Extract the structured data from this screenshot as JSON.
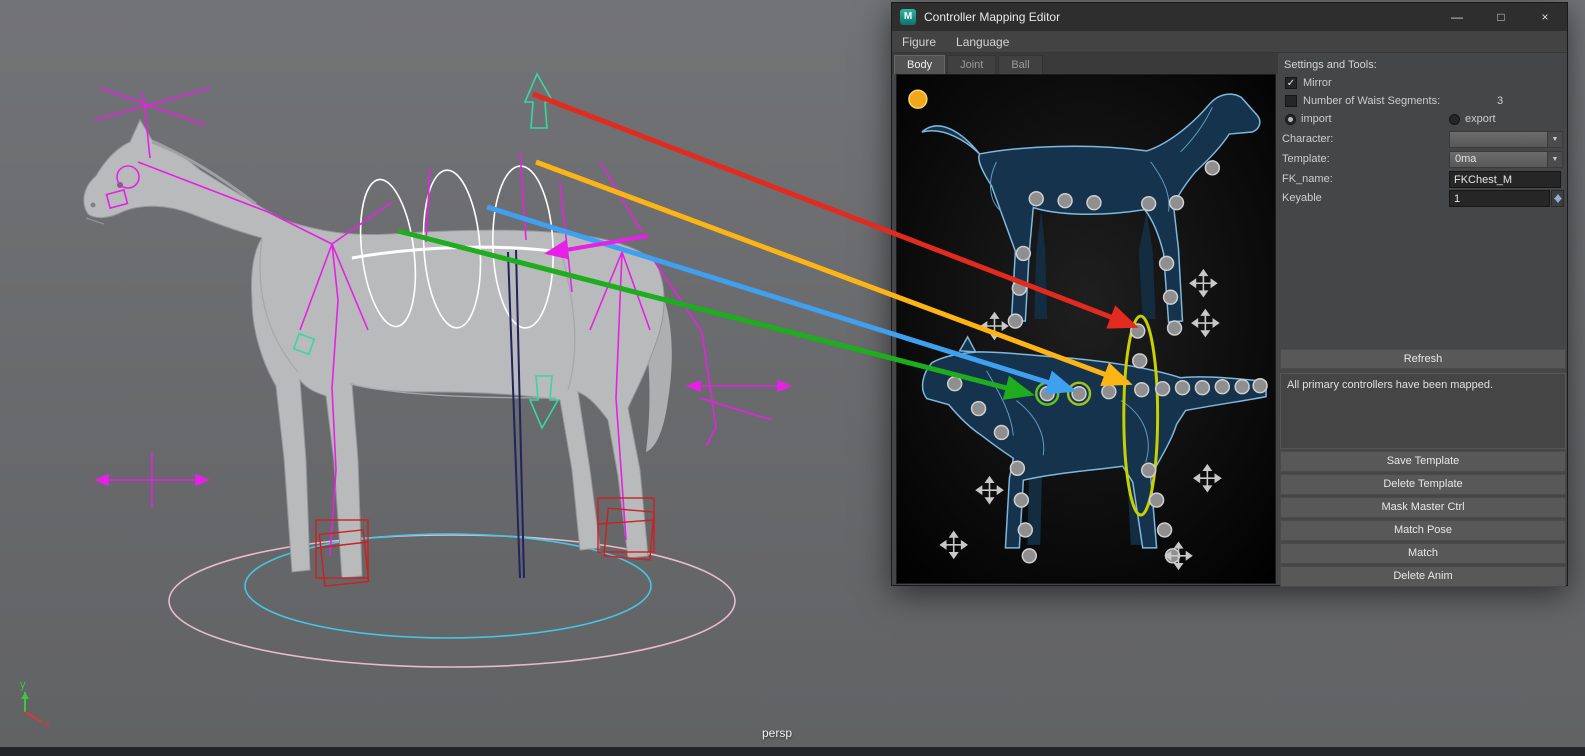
{
  "icons": {
    "check": "✓",
    "dropdown_arrow": "▼",
    "minimize": "—",
    "maximize": "□",
    "close": "×"
  },
  "viewport": {
    "camera_label": "persp",
    "axis_y": "y",
    "axis_x": "x"
  },
  "window": {
    "icon_text": "M",
    "title": "Controller Mapping Editor",
    "menus": [
      {
        "label": "Figure"
      },
      {
        "label": "Language"
      }
    ],
    "tabs": [
      {
        "label": "Body"
      },
      {
        "label": "Joint"
      },
      {
        "label": "Ball"
      }
    ],
    "settings": {
      "header": "Settings and Tools:",
      "mirror_label": "Mirror",
      "waist_label": "Number of Waist Segments:",
      "waist_value": "3",
      "import_label": "import",
      "export_label": "export",
      "character_label": "Character:",
      "character_value": "",
      "template_label": "Template:",
      "template_value": "0ma",
      "fk_name_label": "FK_name:",
      "fk_name_value": "FKChest_M",
      "keyable_label": "Keyable",
      "keyable_value": "1",
      "refresh_label": "Refresh",
      "status_text": "All primary controllers have been mapped.",
      "buttons": [
        "Save Template",
        "Delete Template",
        "Mask Master Ctrl",
        "Match Pose",
        "Match",
        "Delete Anim"
      ]
    }
  },
  "colors": {
    "arrow_red": "#e32a1e",
    "arrow_yellow": "#fdb515",
    "arrow_blue": "#3fa0f0",
    "arrow_green": "#1ead1e",
    "arrow_magenta": "#e620e6",
    "highlight_yellow": "#c9d000",
    "highlight_green": "#63c41e"
  }
}
